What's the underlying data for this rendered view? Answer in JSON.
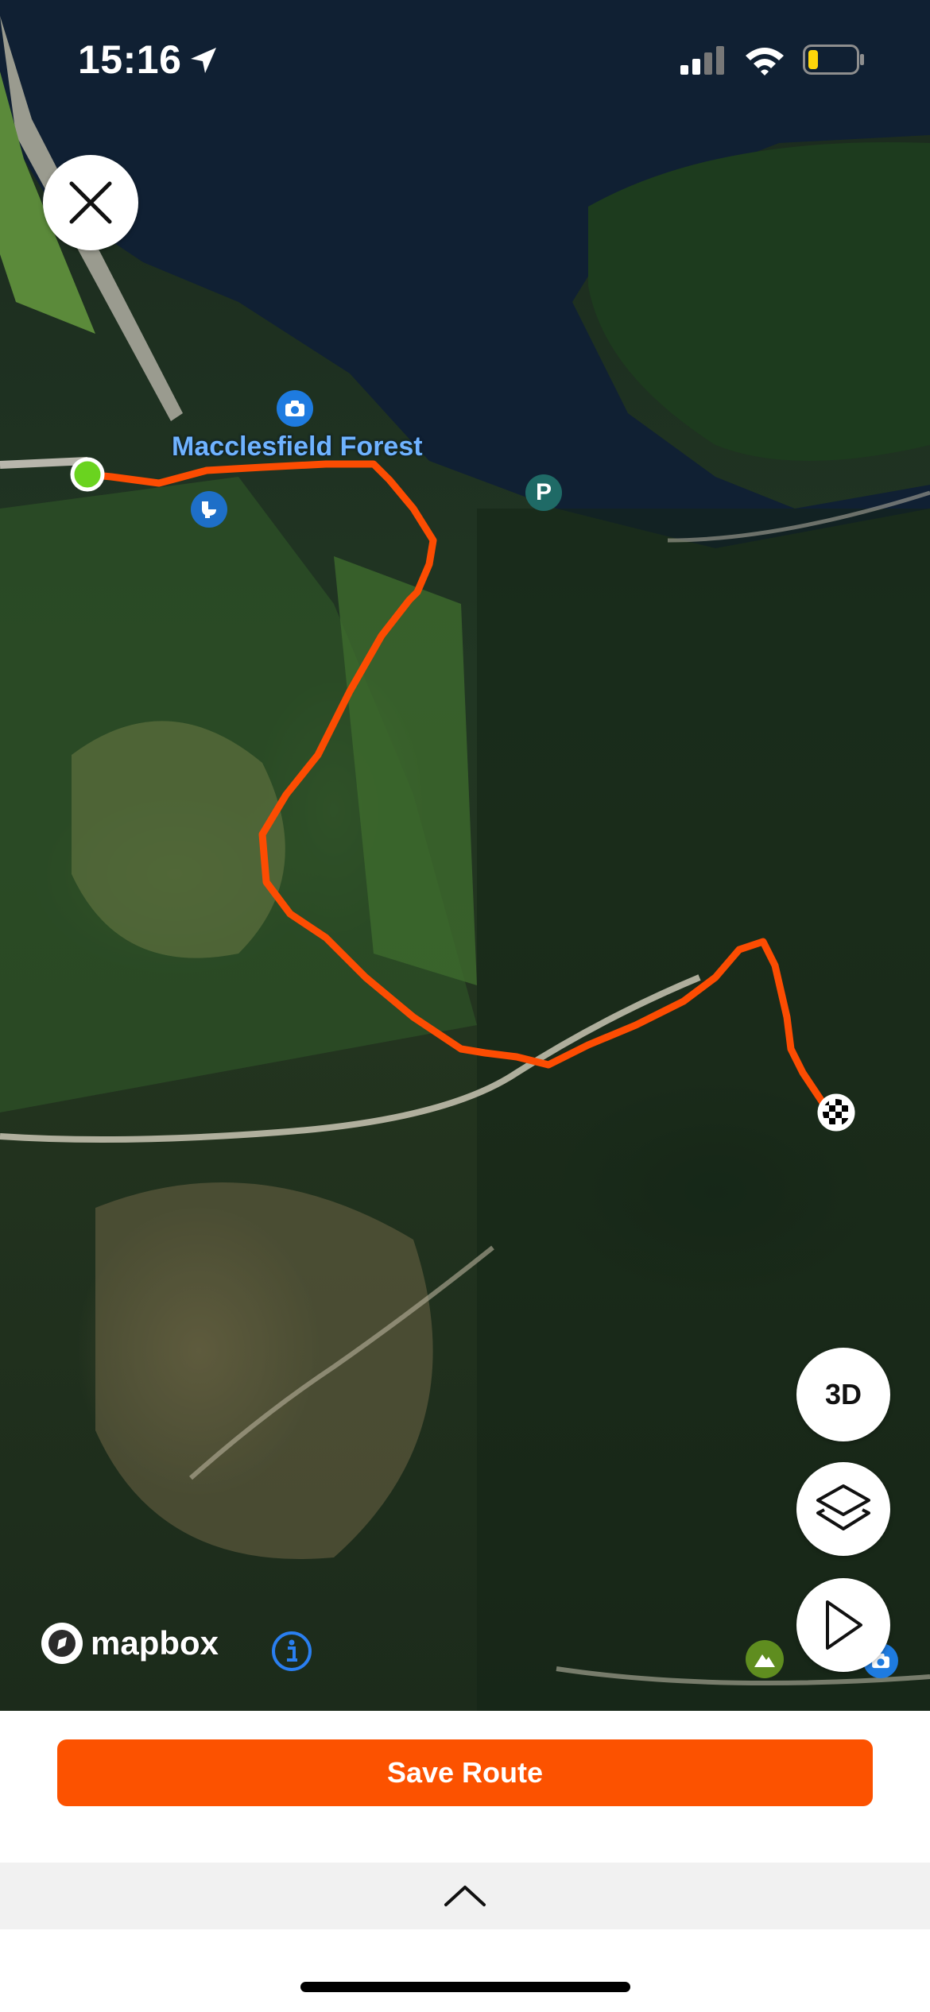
{
  "status_bar": {
    "time": "15:16",
    "location_icon": "location-arrow-icon",
    "signal_icon": "cellular-signal-icon",
    "wifi_icon": "wifi-icon",
    "battery_icon": "battery-low-icon",
    "battery_color": "#ffd60a"
  },
  "map": {
    "provider_logo": "mapbox",
    "place_label": "Macclesfield Forest",
    "poi_icons": [
      "camera-icon",
      "toilet-icon",
      "parking-icon",
      "mountain-icon",
      "camera-icon"
    ],
    "parking_label": "P",
    "route_color": "#fc4c02",
    "start_marker_color": "#6ad31f",
    "end_marker_icon": "checkered-flag-icon"
  },
  "controls": {
    "close_icon": "close-icon",
    "toggle_3d_label": "3D",
    "layers_icon": "layers-icon",
    "play_icon": "play-icon",
    "info_icon": "info-icon"
  },
  "footer": {
    "save_label": "Save Route",
    "save_color": "#fc5200",
    "drawer_icon": "chevron-up-icon"
  }
}
